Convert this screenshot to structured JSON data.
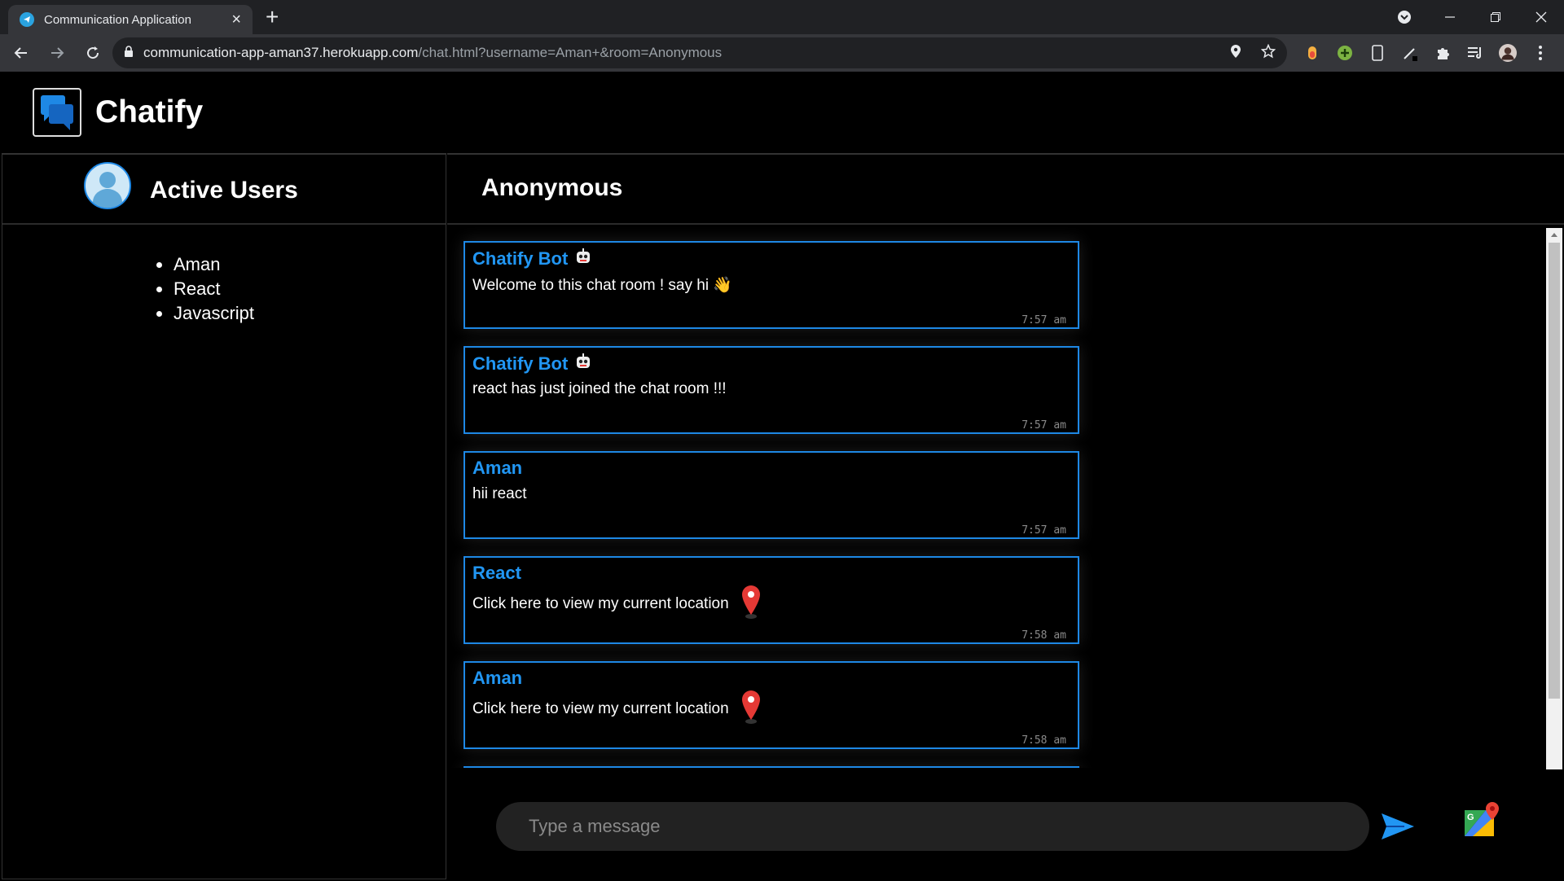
{
  "browser": {
    "tab_title": "Communication Application",
    "url_host": "communication-app-aman37.herokuapp.com",
    "url_path": "/chat.html?username=Aman+&room=Anonymous"
  },
  "app": {
    "brand": "Chatify",
    "sidebar_title": "Active Users",
    "room_title": "Anonymous"
  },
  "users": [
    "Aman",
    "React",
    "Javascript"
  ],
  "messages": [
    {
      "name": "Chatify Bot",
      "text": "Welcome to this chat room ! say hi 👋",
      "time": "7:57 am"
    },
    {
      "name": "Chatify Bot",
      "text": "react has just joined the chat room !!!",
      "time": "7:57 am"
    },
    {
      "name": "Aman",
      "text": "hii react",
      "time": "7:57 am"
    },
    {
      "name": "React",
      "text": "Click here to view my current location",
      "time": "7:58 am"
    },
    {
      "name": "Aman",
      "text": "Click here to view my current location",
      "time": "7:58 am"
    }
  ],
  "composer": {
    "placeholder": "Type a message"
  },
  "colors": {
    "accent": "#2196f3",
    "message_border": "#1e88e5",
    "background": "#000000",
    "pin_red": "#e53935"
  },
  "icons": {
    "bot": "robot-icon",
    "pin": "map-pin-icon",
    "send": "send-icon",
    "maps": "google-maps-icon"
  }
}
